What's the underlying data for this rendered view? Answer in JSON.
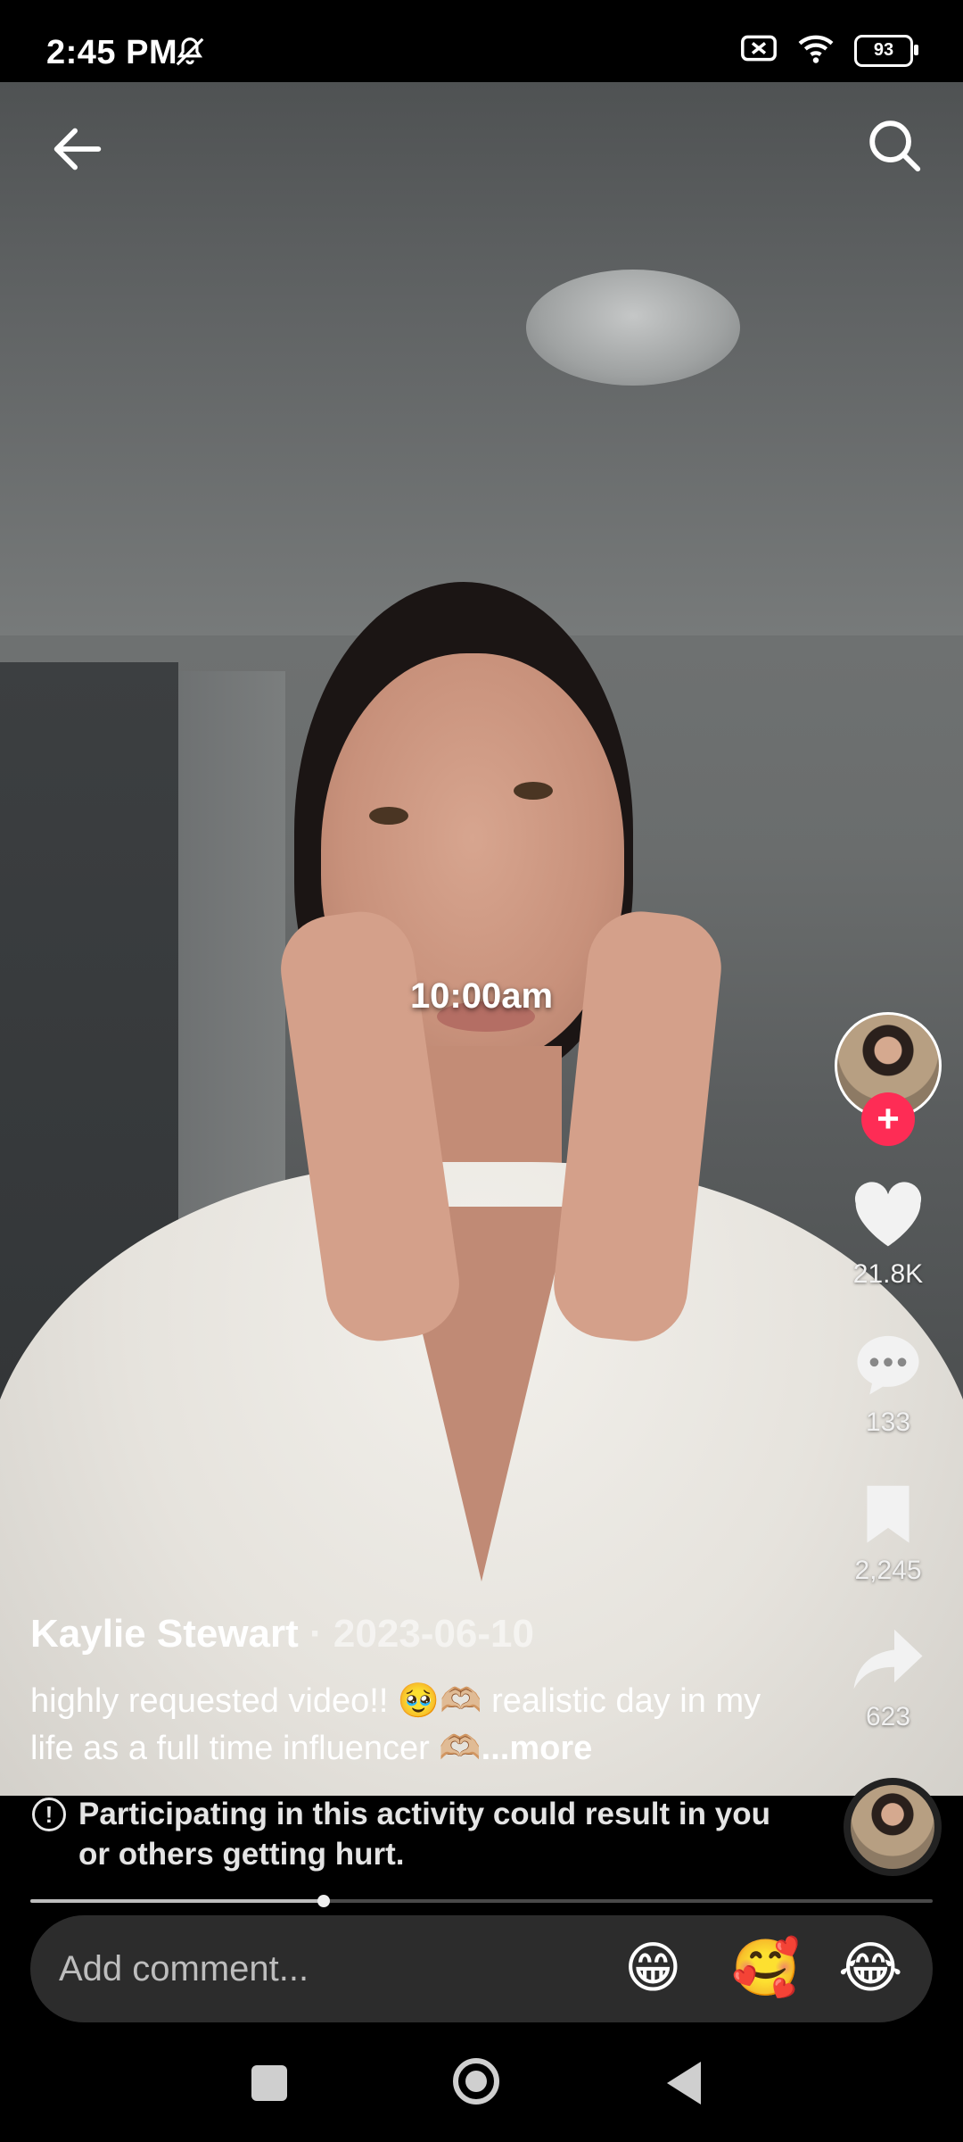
{
  "status_bar": {
    "time": "2:45 PM",
    "battery": "93",
    "icons": [
      "bell-off-icon",
      "close-box-icon",
      "wifi-icon",
      "battery-icon"
    ]
  },
  "top_nav": {
    "back_icon": "arrow-left-icon",
    "search_icon": "search-icon"
  },
  "video": {
    "overlay_text": "10:00am"
  },
  "right_rail": {
    "likes": "21.8K",
    "comments": "133",
    "saves": "2,245",
    "shares": "623",
    "follow_symbol": "+"
  },
  "post": {
    "author": "Kaylie Stewart",
    "separator": " · ",
    "date": "2023-06-10",
    "description": "highly requested video!! 🥹🫶🏼 realistic day in my life as a full time influencer 🫶🏼",
    "more_label": "...more"
  },
  "warning": {
    "icon": "!",
    "text": "Participating in this activity could result in you or others getting hurt."
  },
  "playback": {
    "progress": 0.325
  },
  "comment_bar": {
    "placeholder": "Add comment...",
    "emojis": [
      "😁",
      "🥰",
      "😂"
    ]
  },
  "colors": {
    "follow_accent": "#fe2c55",
    "background": "#000000"
  }
}
